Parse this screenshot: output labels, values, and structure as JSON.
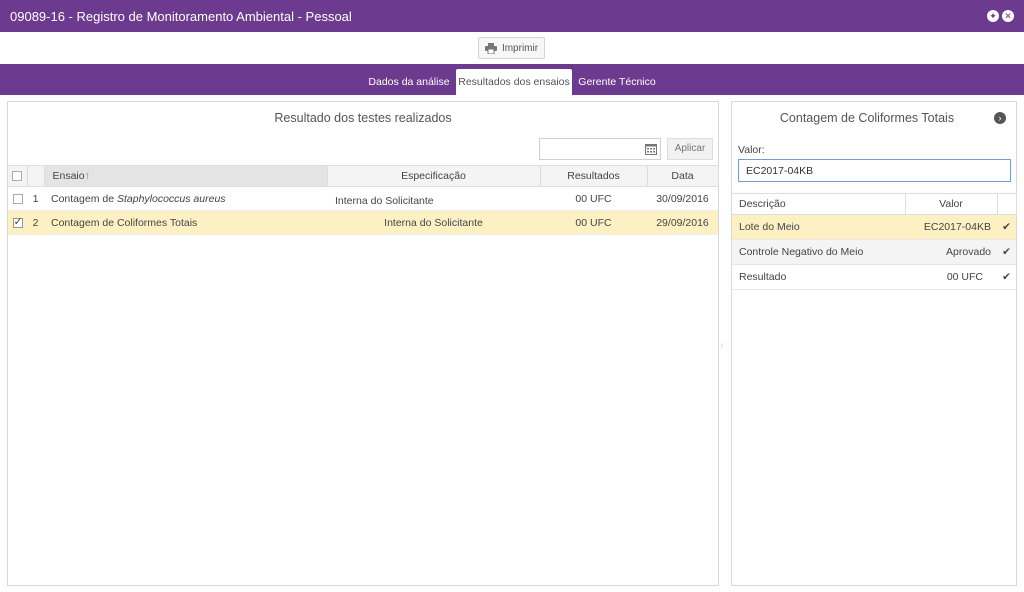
{
  "window": {
    "title": "09089-16 - Registro de Monitoramento Ambiental - Pessoal"
  },
  "toolbar": {
    "print_label": "Imprimir"
  },
  "tabs": [
    {
      "label": "Dados da análise"
    },
    {
      "label": "Resultados dos ensaios"
    },
    {
      "label": "Gerente Técnico"
    }
  ],
  "left_panel": {
    "title": "Resultado dos testes realizados",
    "apply_label": "Aplicar",
    "columns": {
      "ensaio": "Ensaio",
      "sort_indicator": "↑",
      "especificacao": "Especificação",
      "resultados": "Resultados",
      "data": "Data"
    },
    "rows": [
      {
        "num": "1",
        "ensaio_prefix": "Contagem de ",
        "ensaio_italic": "Staphylococcus aureus",
        "especificacao": "Interna do Solicitante",
        "resultado": "00 UFC",
        "data": "30/09/2016",
        "checked": false
      },
      {
        "num": "2",
        "ensaio_prefix": "Contagem de Coliformes Totais",
        "ensaio_italic": "",
        "especificacao": "Interna do Solicitante",
        "resultado": "00 UFC",
        "data": "29/09/2016",
        "checked": true
      }
    ]
  },
  "right_panel": {
    "title": "Contagem de Coliformes Totais",
    "valor_label": "Valor:",
    "valor_value": "EC2017-04KB",
    "columns": {
      "descricao": "Descrição",
      "valor": "Valor"
    },
    "rows": [
      {
        "descricao": "Lote do Meio",
        "valor": "EC2017-04KB",
        "check": "✔"
      },
      {
        "descricao": "Controle Negativo do Meio",
        "valor": "Aprovado",
        "check": "✔"
      },
      {
        "descricao": "Resultado",
        "valor": "00 UFC",
        "check": "✔"
      }
    ]
  }
}
